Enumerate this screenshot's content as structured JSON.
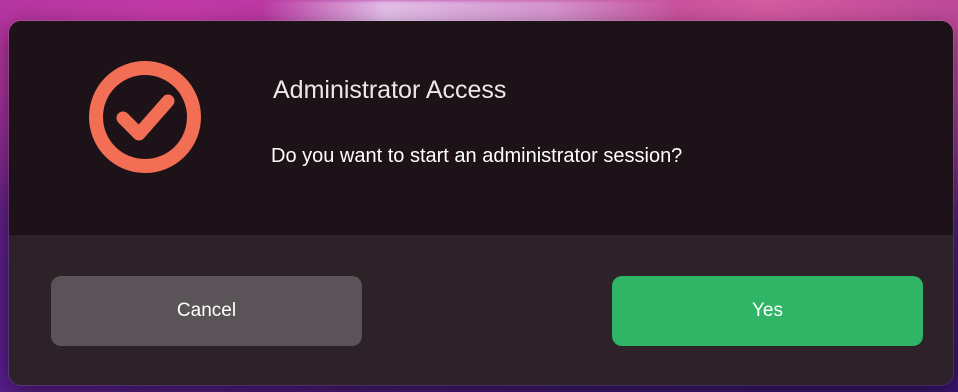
{
  "dialog": {
    "title": "Administrator Access",
    "message": "Do you want to start an administrator session?",
    "icon": "checkmark-circle-icon",
    "accent_color": "#f26f55",
    "buttons": {
      "cancel_label": "Cancel",
      "yes_label": "Yes"
    },
    "colors": {
      "cancel_button": "#5a5458",
      "yes_button": "#2fb565",
      "background_top": "#1e1219",
      "background_bottom": "#2c2228"
    }
  }
}
